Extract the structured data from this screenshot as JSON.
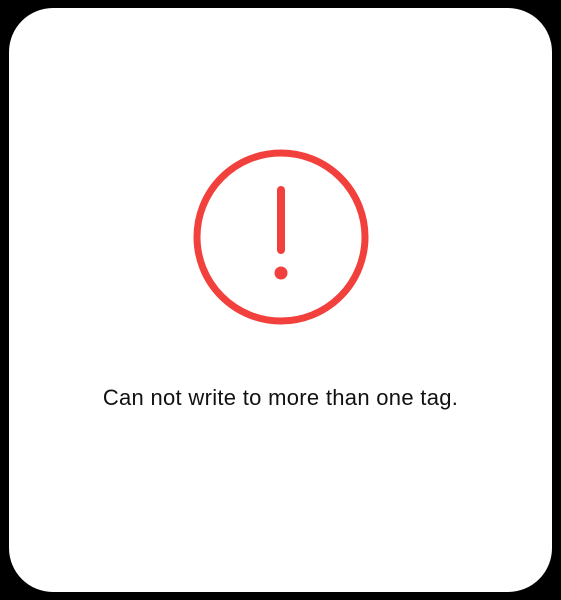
{
  "alert": {
    "icon": "exclamation-circle-icon",
    "accent_color": "#f2403c",
    "message": "Can not write to more than one tag."
  }
}
